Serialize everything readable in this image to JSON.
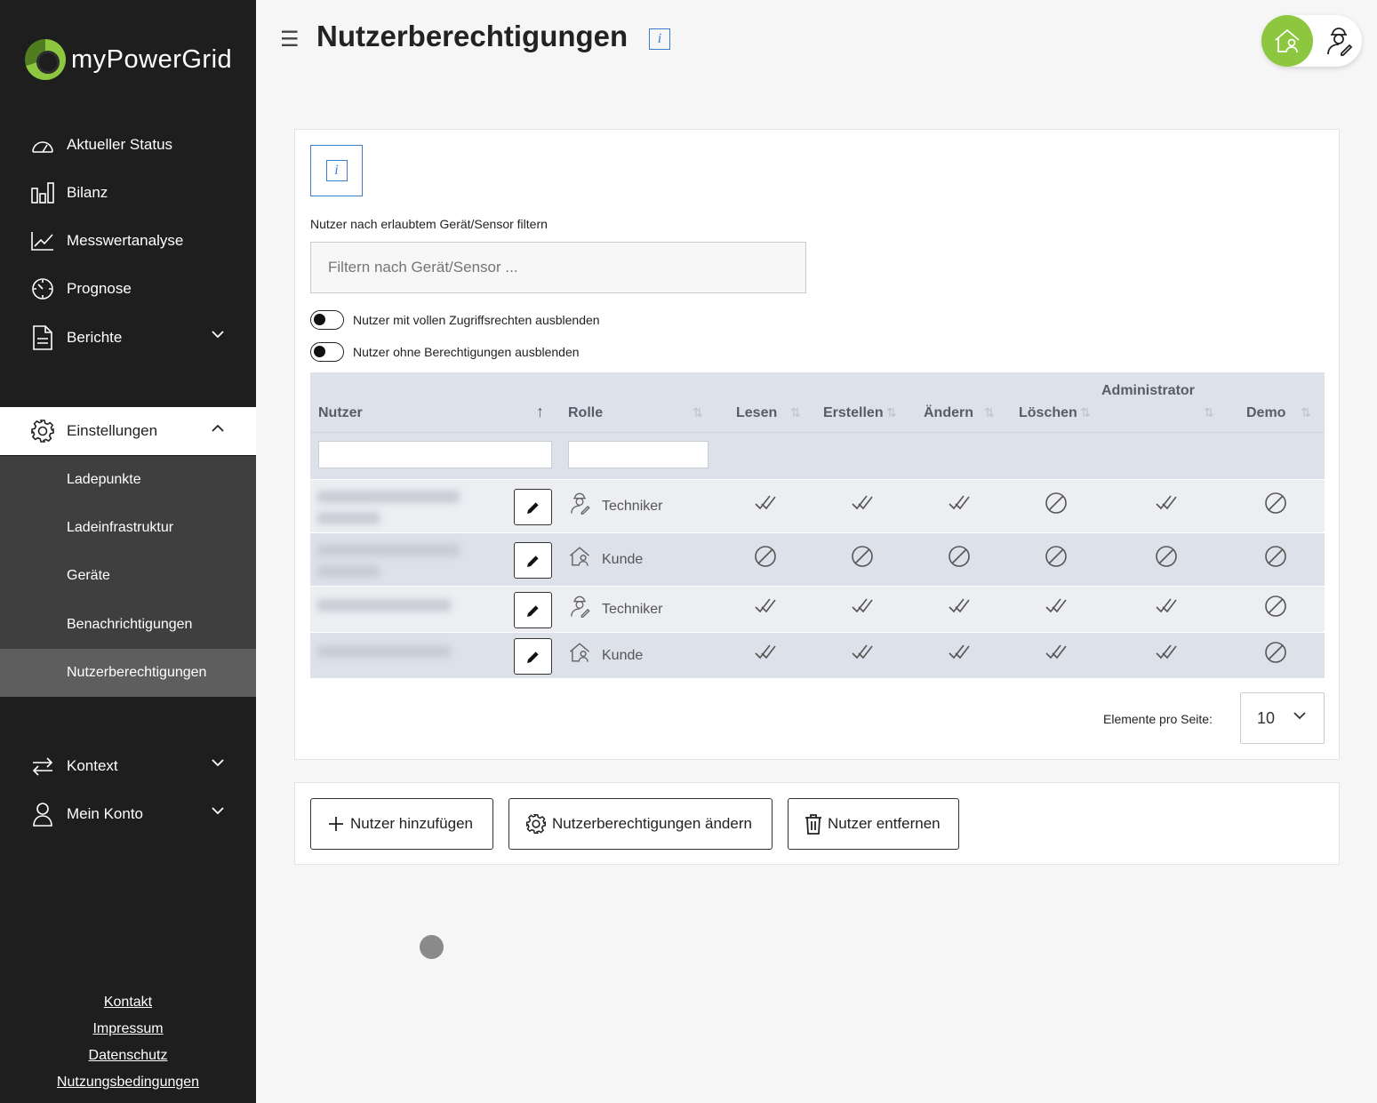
{
  "brand": {
    "name": "myPowerGrid",
    "accent": "#8dc63f"
  },
  "sidebar": {
    "items": [
      {
        "label": "Aktueller Status",
        "icon": "gauge-icon"
      },
      {
        "label": "Bilanz",
        "icon": "bar-chart-icon"
      },
      {
        "label": "Messwertanalyse",
        "icon": "line-chart-icon"
      },
      {
        "label": "Prognose",
        "icon": "clock-icon"
      },
      {
        "label": "Berichte",
        "icon": "document-icon"
      }
    ],
    "settings": {
      "label": "Einstellungen",
      "icon": "gear-icon",
      "sub_items": [
        "Ladepunkte",
        "Ladeinfrastruktur",
        "Geräte",
        "Benachrichtigungen",
        "Nutzerberechtigungen"
      ],
      "active": "Nutzerberechtigungen"
    },
    "bottom_items": [
      {
        "label": "Kontext",
        "icon": "swap-arrows-icon"
      },
      {
        "label": "Mein Konto",
        "icon": "user-icon"
      }
    ],
    "footer_links": [
      "Kontakt",
      "Impressum",
      "Datenschutz",
      "Nutzungsbedingungen"
    ]
  },
  "header": {
    "title": "Nutzerberechtigungen",
    "info_glyph": "i"
  },
  "filter": {
    "label": "Nutzer nach erlaubtem Gerät/Sensor filtern",
    "placeholder": "Filtern nach Gerät/Sensor ...",
    "toggles": [
      "Nutzer mit vollen Zugriffsrechten ausblenden",
      "Nutzer ohne Berechtigungen ausblenden"
    ]
  },
  "table": {
    "columns": {
      "user": "Nutzer",
      "role": "Rolle",
      "read": "Lesen",
      "create": "Erstellen",
      "edit": "Ändern",
      "delete": "Löschen",
      "admin": "Administrator",
      "demo": "Demo"
    },
    "rows": [
      {
        "role": "Techniker",
        "role_icon": "technician-icon",
        "perms": [
          true,
          true,
          true,
          false,
          true,
          false
        ]
      },
      {
        "role": "Kunde",
        "role_icon": "customer-house-icon",
        "perms": [
          false,
          false,
          false,
          false,
          false,
          false
        ]
      },
      {
        "role": "Techniker",
        "role_icon": "technician-icon",
        "perms": [
          true,
          true,
          true,
          true,
          true,
          false
        ]
      },
      {
        "role": "Kunde",
        "role_icon": "customer-house-icon",
        "perms": [
          true,
          true,
          true,
          true,
          true,
          false
        ]
      }
    ]
  },
  "pager": {
    "label": "Elemente pro Seite:",
    "value": "10"
  },
  "actions": {
    "add": "Nutzer hinzufügen",
    "change": "Nutzerberechtigungen ändern",
    "remove": "Nutzer entfernen"
  }
}
